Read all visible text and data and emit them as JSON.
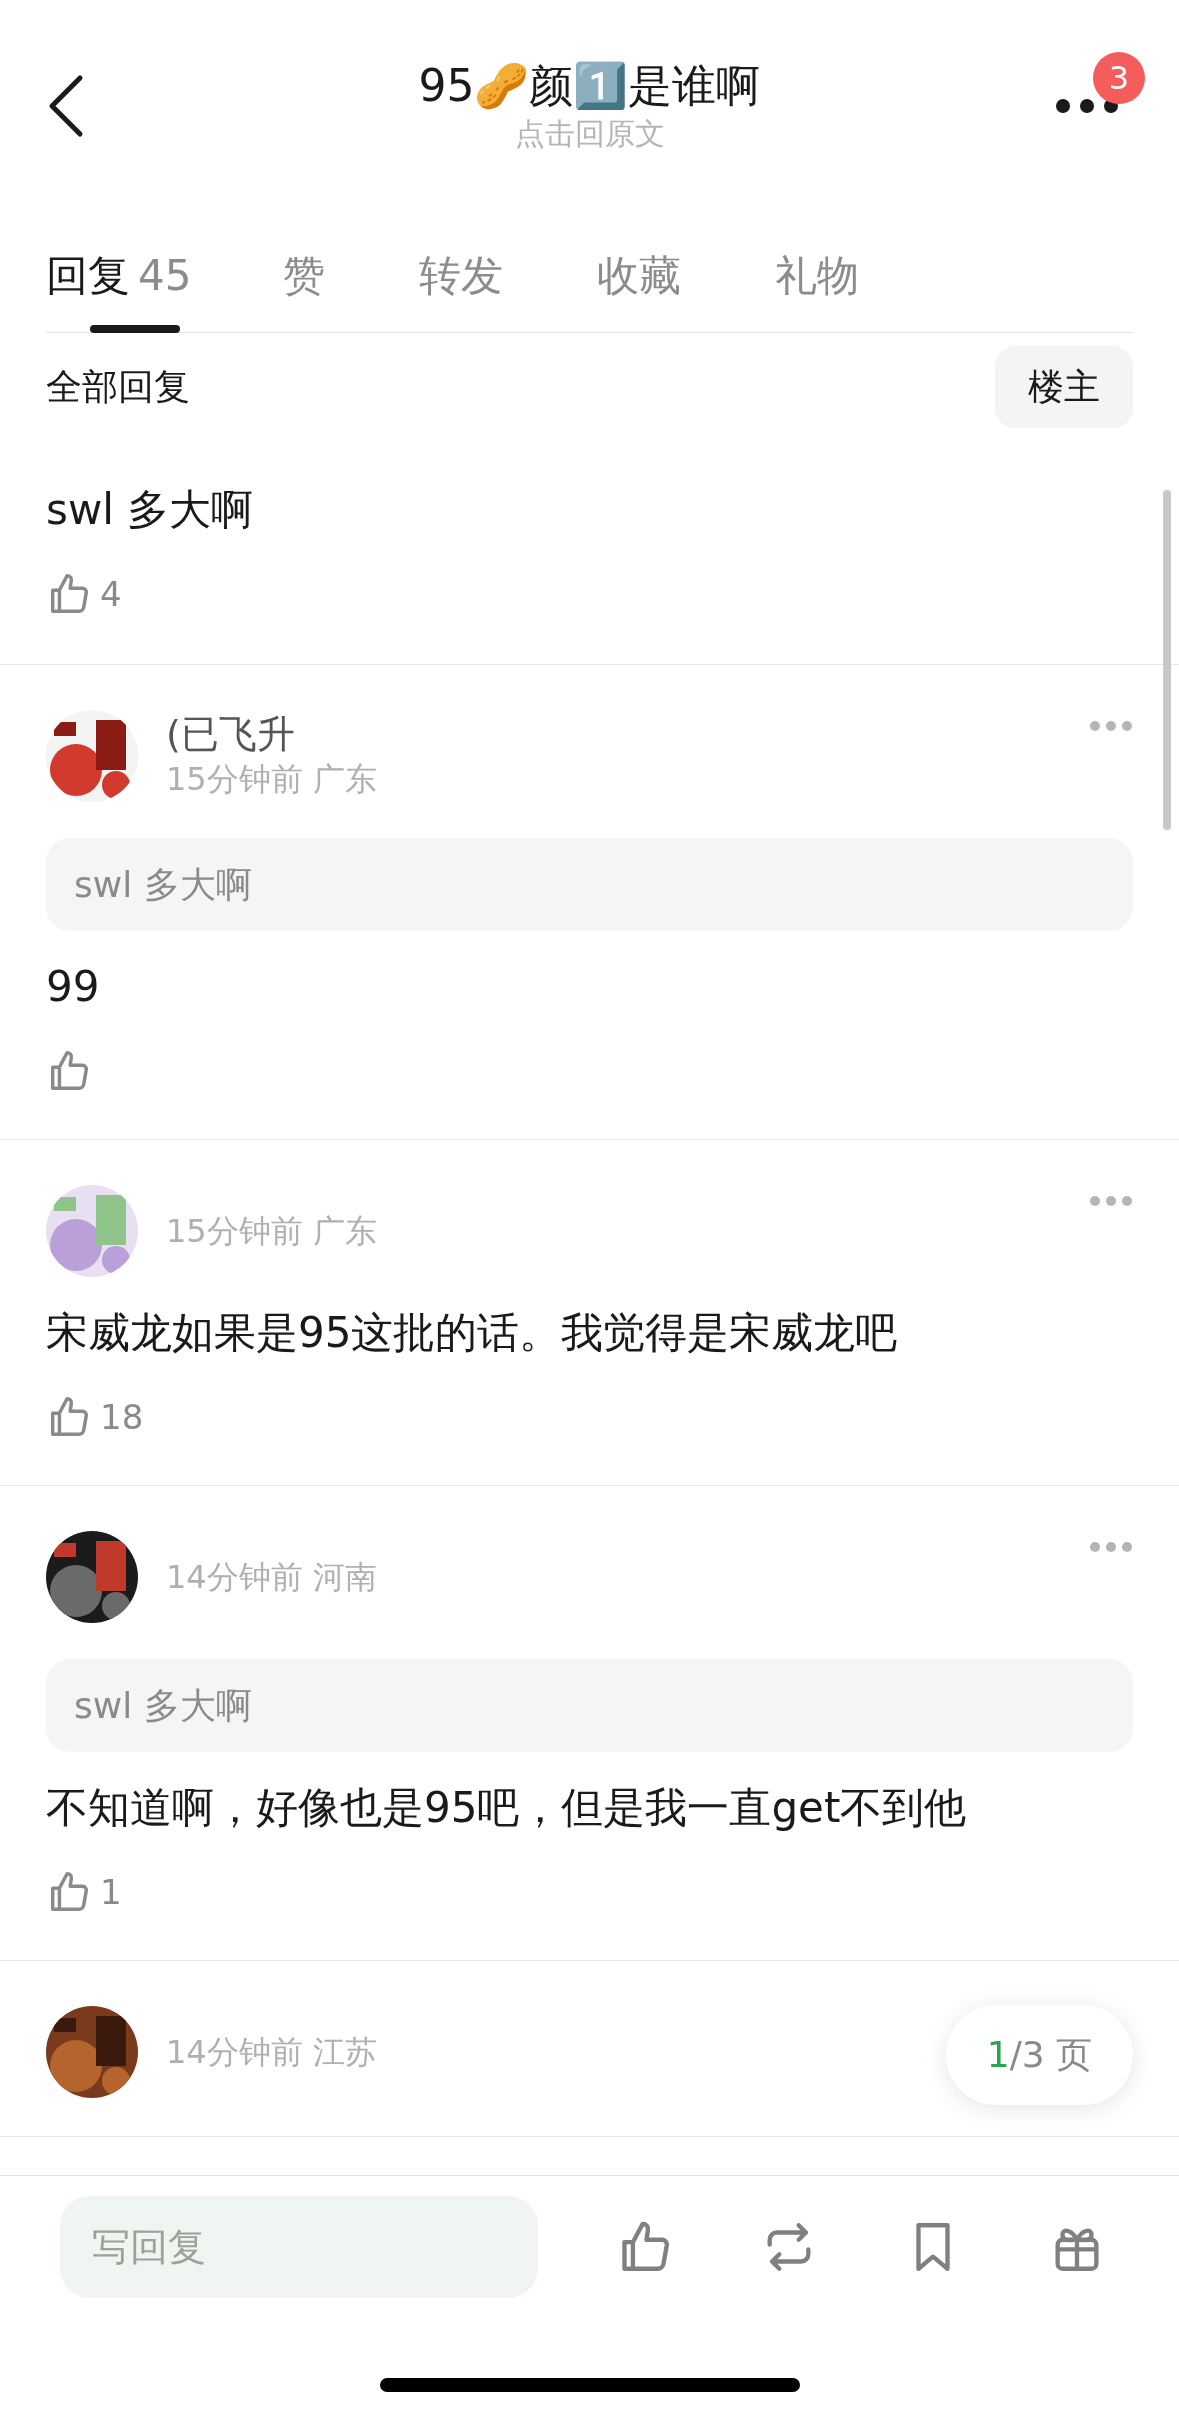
{
  "header": {
    "title": "95🥜颜1️⃣是谁啊",
    "subtitle": "点击回原文",
    "badge": "3"
  },
  "tabs": [
    {
      "label": "回复",
      "count": "45",
      "selected": true
    },
    {
      "label": "赞",
      "selected": false
    },
    {
      "label": "转发",
      "selected": false
    },
    {
      "label": "收藏",
      "selected": false
    },
    {
      "label": "礼物",
      "selected": false
    }
  ],
  "filter": {
    "label": "全部回复",
    "button": "楼主"
  },
  "comments": [
    {
      "kind": "plain",
      "text": "swl 多大啊",
      "likes": "4"
    },
    {
      "kind": "full",
      "name": "(已飞升",
      "meta": "15分钟前 广东",
      "quote": "swl 多大啊",
      "text": "99"
    },
    {
      "kind": "full",
      "meta": "15分钟前 广东",
      "text": "宋威龙如果是95这批的话。我觉得是宋威龙吧",
      "likes": "18"
    },
    {
      "kind": "full",
      "meta": "14分钟前 河南",
      "quote": "swl 多大啊",
      "text": "不知道啊，好像也是95吧，但是我一直get不到他",
      "likes": "1"
    },
    {
      "kind": "full",
      "meta": "14分钟前 江苏"
    }
  ],
  "pager": {
    "current": "1",
    "rest": "/3 页"
  },
  "composer": {
    "placeholder": "写回复"
  }
}
